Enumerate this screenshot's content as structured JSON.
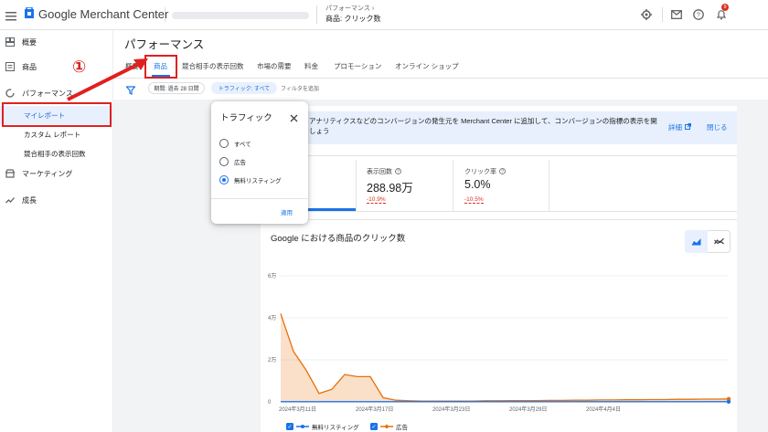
{
  "topbar": {
    "app_name": "Google Merchant Center",
    "breadcrumb_parent": "パフォーマンス",
    "breadcrumb_current": "商品: クリック数",
    "notification_count": "9"
  },
  "sidebar": {
    "items": [
      {
        "label": "概要",
        "icon": "overview-icon"
      },
      {
        "label": "商品",
        "icon": "products-icon"
      },
      {
        "label": "パフォーマンス",
        "icon": "performance-icon"
      },
      {
        "label": "マイレポート"
      },
      {
        "label": "カスタム レポート"
      },
      {
        "label": "競合相手の表示回数"
      },
      {
        "label": "マーケティング",
        "icon": "marketing-icon"
      },
      {
        "label": "成長",
        "icon": "growth-icon"
      }
    ]
  },
  "main": {
    "title": "パフォーマンス",
    "tabs": [
      "概要",
      "商品",
      "競合相手の表示回数",
      "市場の需要",
      "料金",
      "プロモーション",
      "オンライン ショップ"
    ],
    "active_tab": "商品",
    "filters": {
      "period": "期間: 過去 28 日間",
      "traffic": "トラフィック: すべて",
      "add_filter": "フィルタを追加"
    },
    "banner": {
      "text_line1": "アナリティクスなどのコンバージョンの発生元を Merchant Center に追加して、コンバージョンの指標の表示を開",
      "text_line2": "しょう",
      "details_link": "詳細",
      "close_link": "閉じる"
    },
    "kpis": [
      {
        "label": "表示回数",
        "value": "288.98万",
        "delta": "-10.9%"
      },
      {
        "label": "クリック率",
        "value": "5.0%",
        "delta": "-10.5%"
      }
    ],
    "chart_title": "Google における商品のクリック数"
  },
  "chart_data": {
    "type": "area",
    "title": "Google における商品のクリック数",
    "yticks": [
      "0",
      "2万",
      "4万",
      "6万"
    ],
    "ylim": [
      0,
      60000
    ],
    "xticks": [
      "2024年3月11日",
      "2024年3月17日",
      "2024年3月23日",
      "2024年3月29日",
      "2024年4月4日"
    ],
    "x": [
      0,
      1,
      2,
      3,
      4,
      5,
      6,
      7,
      8,
      9,
      10,
      11,
      12,
      13,
      14,
      15,
      16,
      17,
      18,
      19,
      20,
      21,
      22,
      23,
      24,
      25,
      26,
      27,
      28,
      29,
      30,
      31,
      32,
      33,
      34,
      35
    ],
    "series": [
      {
        "name": "広告",
        "color": "#e8710a",
        "values": [
          42000,
          24000,
          15000,
          4000,
          6000,
          13000,
          12000,
          12000,
          2000,
          800,
          500,
          400,
          400,
          400,
          400,
          400,
          500,
          500,
          600,
          600,
          600,
          700,
          700,
          800,
          800,
          900,
          900,
          1000,
          1000,
          1100,
          1100,
          1200,
          1200,
          1300,
          1300,
          1400
        ]
      },
      {
        "name": "無料リスティング",
        "color": "#1a73e8",
        "values": [
          100,
          100,
          100,
          100,
          100,
          100,
          100,
          100,
          100,
          100,
          100,
          100,
          100,
          100,
          100,
          100,
          100,
          100,
          100,
          100,
          100,
          100,
          100,
          100,
          100,
          100,
          100,
          100,
          100,
          100,
          100,
          100,
          100,
          100,
          100,
          100
        ]
      }
    ],
    "legend": [
      "無料リスティング",
      "広告"
    ],
    "legend_position": "bottom"
  },
  "popup": {
    "title": "トラフィック",
    "options": [
      "すべて",
      "広告",
      "無料リスティング"
    ],
    "selected": "無料リスティング",
    "apply_label": "適用"
  },
  "annotation": {
    "step_number": "①"
  }
}
